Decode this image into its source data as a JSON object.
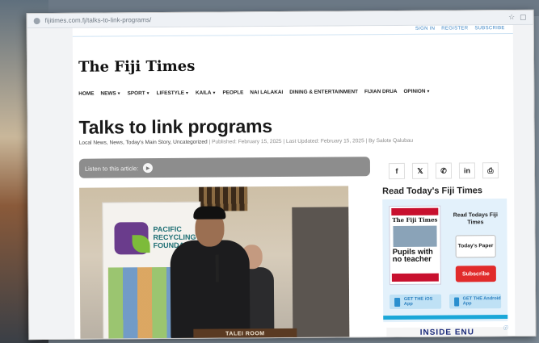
{
  "browser": {
    "url": "fijitimes.com.fj/talks-to-link-programs/"
  },
  "header": {
    "auth_links": [
      "SIGN IN",
      "REGISTER",
      "SUBSCRIBE"
    ],
    "logo": "The Fiji Times"
  },
  "nav": {
    "items": [
      {
        "label": "HOME",
        "dropdown": false
      },
      {
        "label": "NEWS",
        "dropdown": true
      },
      {
        "label": "SPORT",
        "dropdown": true
      },
      {
        "label": "LIFESTYLE",
        "dropdown": true
      },
      {
        "label": "KAILA",
        "dropdown": true
      },
      {
        "label": "PEOPLE",
        "dropdown": false
      },
      {
        "label": "NAI LALAKAI",
        "dropdown": false
      },
      {
        "label": "DINING & ENTERTAINMENT",
        "dropdown": false
      },
      {
        "label": "FIJIAN DRUA",
        "dropdown": false
      },
      {
        "label": "OPINION",
        "dropdown": true
      }
    ]
  },
  "article": {
    "title": "Talks to link programs",
    "categories": "Local News, News, Today's Main Story, Uncategorized",
    "published": "| Published: February 15, 2025 | Last Updated: February 15, 2025 | By Salote Qalubau",
    "listen_label": "Listen to this article:",
    "photo": {
      "banner_brand": "PACIFIC RECYCLING FOUNDATION",
      "podium_text": "TALEI ROOM"
    }
  },
  "share": {
    "buttons": [
      {
        "name": "facebook-icon",
        "glyph": "f"
      },
      {
        "name": "twitter-icon",
        "glyph": "𝕏"
      },
      {
        "name": "whatsapp-icon",
        "glyph": "✆"
      },
      {
        "name": "linkedin-icon",
        "glyph": "in"
      },
      {
        "name": "print-icon",
        "glyph": "⎙"
      }
    ]
  },
  "sidebar": {
    "title": "Read Today's Fiji Times",
    "epaper": {
      "cover_masthead": "The Fiji Times",
      "cover_headline": "Pupils with no teacher",
      "heading": "Read Todays Fiji Times",
      "todays_paper": "Today's Paper",
      "subscribe": "Subscribe",
      "ios_app": "GET THE iOS App",
      "android_app": "GET THE Android App"
    },
    "ad_text": "INSIDE ENU"
  },
  "colors": {
    "accent_blue": "#3b84c4",
    "subscribe_red": "#e12b2b",
    "epaper_bg": "#e3f1fb",
    "listen_bar": "#8d8d8d"
  }
}
